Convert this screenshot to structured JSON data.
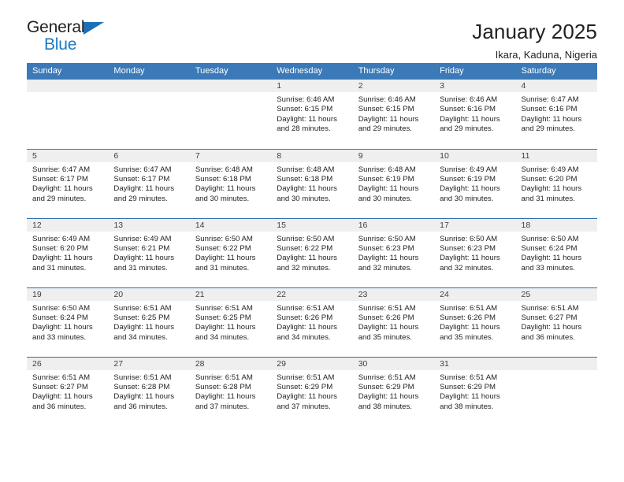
{
  "brand": {
    "name_part1": "General",
    "name_part2": "Blue",
    "triangle_icon": "triangle-icon",
    "accent_blue": "#1d70b7"
  },
  "header": {
    "title": "January 2025",
    "subtitle": "Ikara, Kaduna, Nigeria"
  },
  "theme": {
    "header_row_bg": "#3b79b8",
    "week_separator": "#2f6fb0",
    "daynum_band_bg": "#efefef",
    "text": "#231f20"
  },
  "weekday_headers": [
    "Sunday",
    "Monday",
    "Tuesday",
    "Wednesday",
    "Thursday",
    "Friday",
    "Saturday"
  ],
  "weeks": [
    [
      {
        "day": "",
        "sunrise": "",
        "sunset": "",
        "daylight_line1": "",
        "daylight_line2": ""
      },
      {
        "day": "",
        "sunrise": "",
        "sunset": "",
        "daylight_line1": "",
        "daylight_line2": ""
      },
      {
        "day": "",
        "sunrise": "",
        "sunset": "",
        "daylight_line1": "",
        "daylight_line2": ""
      },
      {
        "day": "1",
        "sunrise": "Sunrise: 6:46 AM",
        "sunset": "Sunset: 6:15 PM",
        "daylight_line1": "Daylight: 11 hours",
        "daylight_line2": "and 28 minutes."
      },
      {
        "day": "2",
        "sunrise": "Sunrise: 6:46 AM",
        "sunset": "Sunset: 6:15 PM",
        "daylight_line1": "Daylight: 11 hours",
        "daylight_line2": "and 29 minutes."
      },
      {
        "day": "3",
        "sunrise": "Sunrise: 6:46 AM",
        "sunset": "Sunset: 6:16 PM",
        "daylight_line1": "Daylight: 11 hours",
        "daylight_line2": "and 29 minutes."
      },
      {
        "day": "4",
        "sunrise": "Sunrise: 6:47 AM",
        "sunset": "Sunset: 6:16 PM",
        "daylight_line1": "Daylight: 11 hours",
        "daylight_line2": "and 29 minutes."
      }
    ],
    [
      {
        "day": "5",
        "sunrise": "Sunrise: 6:47 AM",
        "sunset": "Sunset: 6:17 PM",
        "daylight_line1": "Daylight: 11 hours",
        "daylight_line2": "and 29 minutes."
      },
      {
        "day": "6",
        "sunrise": "Sunrise: 6:47 AM",
        "sunset": "Sunset: 6:17 PM",
        "daylight_line1": "Daylight: 11 hours",
        "daylight_line2": "and 29 minutes."
      },
      {
        "day": "7",
        "sunrise": "Sunrise: 6:48 AM",
        "sunset": "Sunset: 6:18 PM",
        "daylight_line1": "Daylight: 11 hours",
        "daylight_line2": "and 30 minutes."
      },
      {
        "day": "8",
        "sunrise": "Sunrise: 6:48 AM",
        "sunset": "Sunset: 6:18 PM",
        "daylight_line1": "Daylight: 11 hours",
        "daylight_line2": "and 30 minutes."
      },
      {
        "day": "9",
        "sunrise": "Sunrise: 6:48 AM",
        "sunset": "Sunset: 6:19 PM",
        "daylight_line1": "Daylight: 11 hours",
        "daylight_line2": "and 30 minutes."
      },
      {
        "day": "10",
        "sunrise": "Sunrise: 6:49 AM",
        "sunset": "Sunset: 6:19 PM",
        "daylight_line1": "Daylight: 11 hours",
        "daylight_line2": "and 30 minutes."
      },
      {
        "day": "11",
        "sunrise": "Sunrise: 6:49 AM",
        "sunset": "Sunset: 6:20 PM",
        "daylight_line1": "Daylight: 11 hours",
        "daylight_line2": "and 31 minutes."
      }
    ],
    [
      {
        "day": "12",
        "sunrise": "Sunrise: 6:49 AM",
        "sunset": "Sunset: 6:20 PM",
        "daylight_line1": "Daylight: 11 hours",
        "daylight_line2": "and 31 minutes."
      },
      {
        "day": "13",
        "sunrise": "Sunrise: 6:49 AM",
        "sunset": "Sunset: 6:21 PM",
        "daylight_line1": "Daylight: 11 hours",
        "daylight_line2": "and 31 minutes."
      },
      {
        "day": "14",
        "sunrise": "Sunrise: 6:50 AM",
        "sunset": "Sunset: 6:22 PM",
        "daylight_line1": "Daylight: 11 hours",
        "daylight_line2": "and 31 minutes."
      },
      {
        "day": "15",
        "sunrise": "Sunrise: 6:50 AM",
        "sunset": "Sunset: 6:22 PM",
        "daylight_line1": "Daylight: 11 hours",
        "daylight_line2": "and 32 minutes."
      },
      {
        "day": "16",
        "sunrise": "Sunrise: 6:50 AM",
        "sunset": "Sunset: 6:23 PM",
        "daylight_line1": "Daylight: 11 hours",
        "daylight_line2": "and 32 minutes."
      },
      {
        "day": "17",
        "sunrise": "Sunrise: 6:50 AM",
        "sunset": "Sunset: 6:23 PM",
        "daylight_line1": "Daylight: 11 hours",
        "daylight_line2": "and 32 minutes."
      },
      {
        "day": "18",
        "sunrise": "Sunrise: 6:50 AM",
        "sunset": "Sunset: 6:24 PM",
        "daylight_line1": "Daylight: 11 hours",
        "daylight_line2": "and 33 minutes."
      }
    ],
    [
      {
        "day": "19",
        "sunrise": "Sunrise: 6:50 AM",
        "sunset": "Sunset: 6:24 PM",
        "daylight_line1": "Daylight: 11 hours",
        "daylight_line2": "and 33 minutes."
      },
      {
        "day": "20",
        "sunrise": "Sunrise: 6:51 AM",
        "sunset": "Sunset: 6:25 PM",
        "daylight_line1": "Daylight: 11 hours",
        "daylight_line2": "and 34 minutes."
      },
      {
        "day": "21",
        "sunrise": "Sunrise: 6:51 AM",
        "sunset": "Sunset: 6:25 PM",
        "daylight_line1": "Daylight: 11 hours",
        "daylight_line2": "and 34 minutes."
      },
      {
        "day": "22",
        "sunrise": "Sunrise: 6:51 AM",
        "sunset": "Sunset: 6:26 PM",
        "daylight_line1": "Daylight: 11 hours",
        "daylight_line2": "and 34 minutes."
      },
      {
        "day": "23",
        "sunrise": "Sunrise: 6:51 AM",
        "sunset": "Sunset: 6:26 PM",
        "daylight_line1": "Daylight: 11 hours",
        "daylight_line2": "and 35 minutes."
      },
      {
        "day": "24",
        "sunrise": "Sunrise: 6:51 AM",
        "sunset": "Sunset: 6:26 PM",
        "daylight_line1": "Daylight: 11 hours",
        "daylight_line2": "and 35 minutes."
      },
      {
        "day": "25",
        "sunrise": "Sunrise: 6:51 AM",
        "sunset": "Sunset: 6:27 PM",
        "daylight_line1": "Daylight: 11 hours",
        "daylight_line2": "and 36 minutes."
      }
    ],
    [
      {
        "day": "26",
        "sunrise": "Sunrise: 6:51 AM",
        "sunset": "Sunset: 6:27 PM",
        "daylight_line1": "Daylight: 11 hours",
        "daylight_line2": "and 36 minutes."
      },
      {
        "day": "27",
        "sunrise": "Sunrise: 6:51 AM",
        "sunset": "Sunset: 6:28 PM",
        "daylight_line1": "Daylight: 11 hours",
        "daylight_line2": "and 36 minutes."
      },
      {
        "day": "28",
        "sunrise": "Sunrise: 6:51 AM",
        "sunset": "Sunset: 6:28 PM",
        "daylight_line1": "Daylight: 11 hours",
        "daylight_line2": "and 37 minutes."
      },
      {
        "day": "29",
        "sunrise": "Sunrise: 6:51 AM",
        "sunset": "Sunset: 6:29 PM",
        "daylight_line1": "Daylight: 11 hours",
        "daylight_line2": "and 37 minutes."
      },
      {
        "day": "30",
        "sunrise": "Sunrise: 6:51 AM",
        "sunset": "Sunset: 6:29 PM",
        "daylight_line1": "Daylight: 11 hours",
        "daylight_line2": "and 38 minutes."
      },
      {
        "day": "31",
        "sunrise": "Sunrise: 6:51 AM",
        "sunset": "Sunset: 6:29 PM",
        "daylight_line1": "Daylight: 11 hours",
        "daylight_line2": "and 38 minutes."
      },
      {
        "day": "",
        "sunrise": "",
        "sunset": "",
        "daylight_line1": "",
        "daylight_line2": ""
      }
    ]
  ]
}
